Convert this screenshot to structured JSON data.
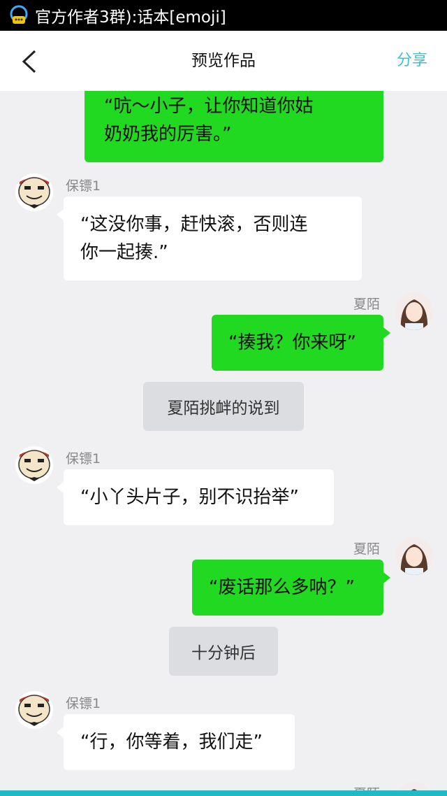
{
  "status_bar": {
    "notification_text": "官方作者3群):话本[emoji]"
  },
  "nav": {
    "title": "预览作品",
    "share_label": "分享"
  },
  "colors": {
    "accent": "#3fbfd0",
    "bubble_green": "#21d921",
    "background": "#f0f0f2",
    "bottom_bar": "#22b8c4"
  },
  "messages": [
    {
      "side": "right",
      "speaker": "",
      "text": "“吭～小子，让你知道你姑奶奶我的厉害。”",
      "line1": "“吭～小子，让你知道你姑",
      "line2": "奶奶我的厉害。”"
    },
    {
      "side": "left",
      "speaker": "保镖1",
      "line1": "“这没你事，赶快滚，否则连",
      "line2": "你一起揍.”"
    },
    {
      "side": "right",
      "speaker": "夏陌",
      "text": "“揍我？你来呀”"
    },
    {
      "type": "narration",
      "text": "夏陌挑衅的说到"
    },
    {
      "side": "left",
      "speaker": "保镖1",
      "text": "“小丫头片子，别不识抬举”"
    },
    {
      "side": "right",
      "speaker": "夏陌",
      "text": "“废话那么多呐？”"
    },
    {
      "type": "narration",
      "text": "十分钟后"
    },
    {
      "side": "left",
      "speaker": "保镖1",
      "text": "“行，你等着，我们走”"
    },
    {
      "side": "right",
      "speaker": "夏陌"
    }
  ]
}
